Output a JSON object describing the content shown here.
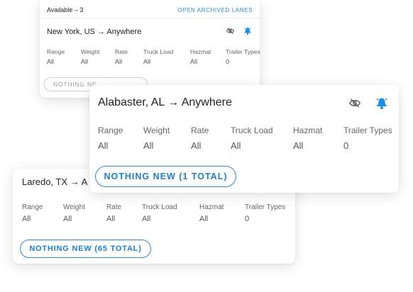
{
  "colors": {
    "accent": "#2a8ad6",
    "bell": "#1a8fe8"
  },
  "card_back": {
    "available_label": "Available  –  3",
    "archived_link": "OPEN ARCHIVED LANES",
    "origin": "New York, US",
    "arrow": "→",
    "destination": "Anywhere",
    "fields": [
      {
        "label": "Range",
        "value": "All"
      },
      {
        "label": "Weight",
        "value": "All"
      },
      {
        "label": "Rate",
        "value": "All"
      },
      {
        "label": "Truck Load",
        "value": "All"
      },
      {
        "label": "Hazmat",
        "value": "All"
      },
      {
        "label": "Trailer Types",
        "value": "0"
      }
    ],
    "button_label": "NOTHING NE"
  },
  "card_front": {
    "origin": "Alabaster, AL",
    "arrow": "→",
    "destination": "Anywhere",
    "fields": [
      {
        "label": "Range",
        "value": "All"
      },
      {
        "label": "Weight",
        "value": "All"
      },
      {
        "label": "Rate",
        "value": "All"
      },
      {
        "label": "Truck Load",
        "value": "All"
      },
      {
        "label": "Hazmat",
        "value": "All"
      },
      {
        "label": "Trailer Types",
        "value": "0"
      }
    ],
    "button_label": "NOTHING NEW (1 TOTAL)",
    "icons": [
      "eye-slash-icon",
      "bell-icon"
    ]
  },
  "card_bottom": {
    "origin": "Laredo, TX",
    "arrow": "→",
    "destination_partial": "A",
    "fields": [
      {
        "label": "Range",
        "value": "All"
      },
      {
        "label": "Weight",
        "value": "All"
      },
      {
        "label": "Rate",
        "value": "All"
      },
      {
        "label": "Truck Load",
        "value": "All"
      },
      {
        "label": "Hazmat",
        "value": "All"
      },
      {
        "label": "Trailer Types",
        "value": "0"
      }
    ],
    "button_label": "NOTHING NEW (65 TOTAL)"
  }
}
